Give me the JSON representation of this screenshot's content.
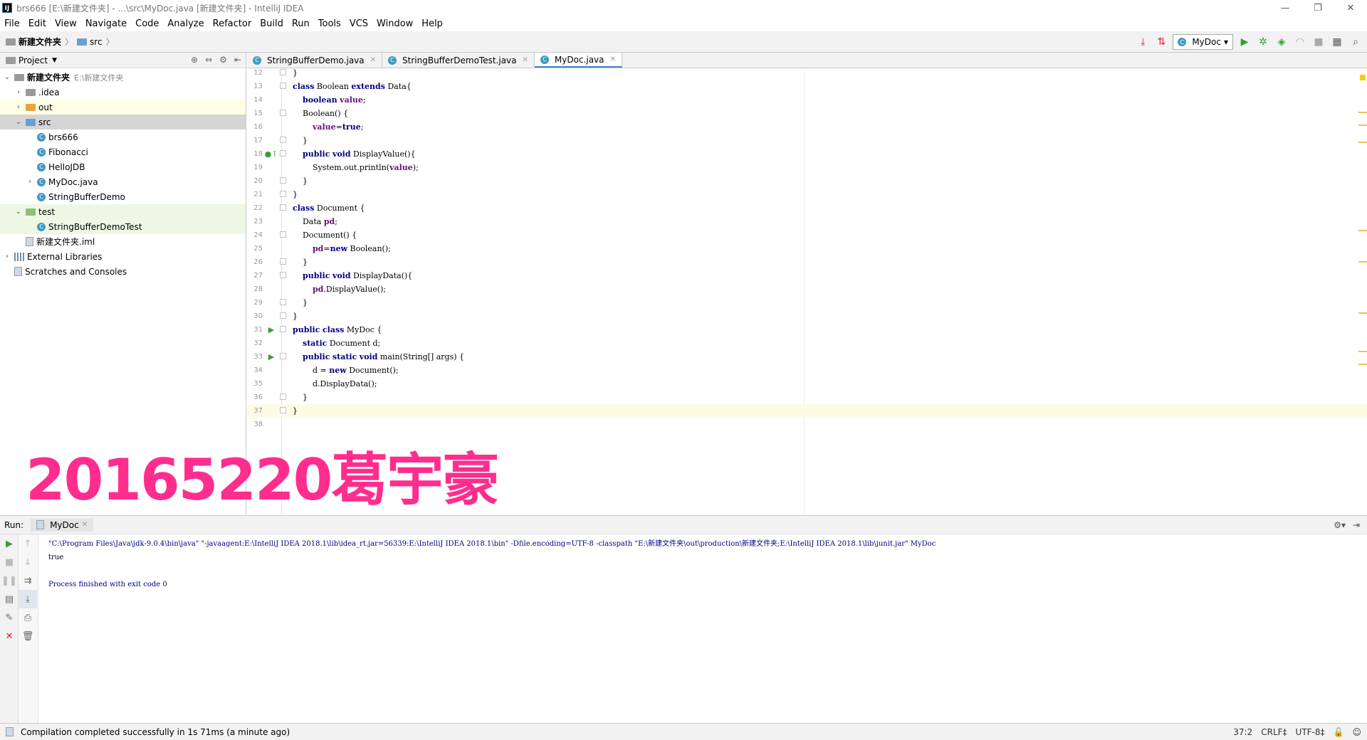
{
  "window": {
    "title": "brs666 [E:\\新建文件夹] - ...\\src\\MyDoc.java [新建文件夹] - IntelliJ IDEA",
    "app_icon": "IJ"
  },
  "menu": [
    "File",
    "Edit",
    "View",
    "Navigate",
    "Code",
    "Analyze",
    "Refactor",
    "Build",
    "Run",
    "Tools",
    "VCS",
    "Window",
    "Help"
  ],
  "breadcrumb": {
    "root": "新建文件夹",
    "child": "src"
  },
  "run_config": "MyDoc",
  "project_panel": {
    "title": "Project",
    "tree": [
      {
        "label": "新建文件夹",
        "extra": "E:\\新建文件夹",
        "indent": 0,
        "arrow": "v",
        "icon": "folder-gray"
      },
      {
        "label": ".idea",
        "extra": "",
        "indent": 1,
        "arrow": ">",
        "icon": "folder-gray"
      },
      {
        "label": "out",
        "extra": "",
        "indent": 1,
        "arrow": ">",
        "icon": "folder-orange"
      },
      {
        "label": "src",
        "extra": "",
        "indent": 1,
        "arrow": "v",
        "icon": "folder-blue"
      },
      {
        "label": "brs666",
        "extra": "",
        "indent": 2,
        "arrow": "",
        "icon": "class"
      },
      {
        "label": "Fibonacci",
        "extra": "",
        "indent": 2,
        "arrow": "",
        "icon": "class"
      },
      {
        "label": "HelloJDB",
        "extra": "",
        "indent": 2,
        "arrow": "",
        "icon": "class"
      },
      {
        "label": "MyDoc.java",
        "extra": "",
        "indent": 2,
        "arrow": ">",
        "icon": "class"
      },
      {
        "label": "StringBufferDemo",
        "extra": "",
        "indent": 2,
        "arrow": "",
        "icon": "class"
      },
      {
        "label": "test",
        "extra": "",
        "indent": 1,
        "arrow": "v",
        "icon": "folder-green"
      },
      {
        "label": "StringBufferDemoTest",
        "extra": "",
        "indent": 2,
        "arrow": "",
        "icon": "class"
      },
      {
        "label": "新建文件夹.iml",
        "extra": "",
        "indent": 1,
        "arrow": "",
        "icon": "file"
      },
      {
        "label": "External Libraries",
        "extra": "",
        "indent": 0,
        "arrow": ">",
        "icon": "lib"
      },
      {
        "label": "Scratches and Consoles",
        "extra": "",
        "indent": 0,
        "arrow": "",
        "icon": "scratch"
      }
    ]
  },
  "tabs": [
    {
      "label": "StringBufferDemo.java",
      "active": false
    },
    {
      "label": "StringBufferDemoTest.java",
      "active": false
    },
    {
      "label": "MyDoc.java",
      "active": true
    }
  ],
  "code_lines": [
    {
      "n": "12",
      "text": "}",
      "fold": true,
      "run": false
    },
    {
      "n": "13",
      "text": "class Boolean extends Data{",
      "fold": true,
      "run": false
    },
    {
      "n": "14",
      "text": "    boolean value;",
      "fold": false,
      "run": false
    },
    {
      "n": "15",
      "text": "    Boolean() {",
      "fold": true,
      "run": false
    },
    {
      "n": "16",
      "text": "        value=true;",
      "fold": false,
      "run": false
    },
    {
      "n": "17",
      "text": "    }",
      "fold": true,
      "run": false
    },
    {
      "n": "18",
      "text": "    public void DisplayValue(){",
      "fold": true,
      "run": false,
      "override": true
    },
    {
      "n": "19",
      "text": "        System.out.println(value);",
      "fold": false,
      "run": false
    },
    {
      "n": "20",
      "text": "    }",
      "fold": true,
      "run": false
    },
    {
      "n": "21",
      "text": "}",
      "fold": true,
      "run": false
    },
    {
      "n": "22",
      "text": "class Document {",
      "fold": true,
      "run": false
    },
    {
      "n": "23",
      "text": "    Data pd;",
      "fold": false,
      "run": false
    },
    {
      "n": "24",
      "text": "    Document() {",
      "fold": true,
      "run": false
    },
    {
      "n": "25",
      "text": "        pd=new Boolean();",
      "fold": false,
      "run": false
    },
    {
      "n": "26",
      "text": "    }",
      "fold": true,
      "run": false
    },
    {
      "n": "27",
      "text": "    public void DisplayData(){",
      "fold": true,
      "run": false
    },
    {
      "n": "28",
      "text": "        pd.DisplayValue();",
      "fold": false,
      "run": false
    },
    {
      "n": "29",
      "text": "    }",
      "fold": true,
      "run": false
    },
    {
      "n": "30",
      "text": "}",
      "fold": true,
      "run": false
    },
    {
      "n": "31",
      "text": "public class MyDoc {",
      "fold": true,
      "run": true
    },
    {
      "n": "32",
      "text": "    static Document d;",
      "fold": false,
      "run": false
    },
    {
      "n": "33",
      "text": "    public static void main(String[] args) {",
      "fold": true,
      "run": true
    },
    {
      "n": "34",
      "text": "        d = new Document();",
      "fold": false,
      "run": false
    },
    {
      "n": "35",
      "text": "        d.DisplayData();",
      "fold": false,
      "run": false
    },
    {
      "n": "36",
      "text": "    }",
      "fold": true,
      "run": false
    },
    {
      "n": "37",
      "text": "}",
      "fold": true,
      "run": false,
      "current": true
    },
    {
      "n": "38",
      "text": "",
      "fold": false,
      "run": false
    }
  ],
  "watermark": "20165220葛宇豪",
  "run_panel": {
    "label": "Run:",
    "tab": "MyDoc",
    "console": [
      {
        "kind": "cmd",
        "text": "\"C:\\Program Files\\Java\\jdk-9.0.4\\bin\\java\" \"-javaagent:E:\\IntelliJ IDEA 2018.1\\lib\\idea_rt.jar=56339:E:\\IntelliJ IDEA 2018.1\\bin\" -Dfile.encoding=UTF-8 -classpath \"E:\\新建文件夹\\out\\production\\新建文件夹;E:\\IntelliJ IDEA 2018.1\\lib\\junit.jar\" MyDoc"
      },
      {
        "kind": "out",
        "text": "true"
      },
      {
        "kind": "blank",
        "text": ""
      },
      {
        "kind": "exit",
        "text": "Process finished with exit code 0"
      }
    ]
  },
  "status": {
    "message": "Compilation completed successfully in 1s 71ms (a minute ago)",
    "position": "37:2",
    "line_sep": "CRLF‡",
    "encoding": "UTF-8‡"
  },
  "colors": {
    "accent": "#4083c9",
    "watermark": "#ff2d8e",
    "run_green": "#3a9d3a"
  }
}
